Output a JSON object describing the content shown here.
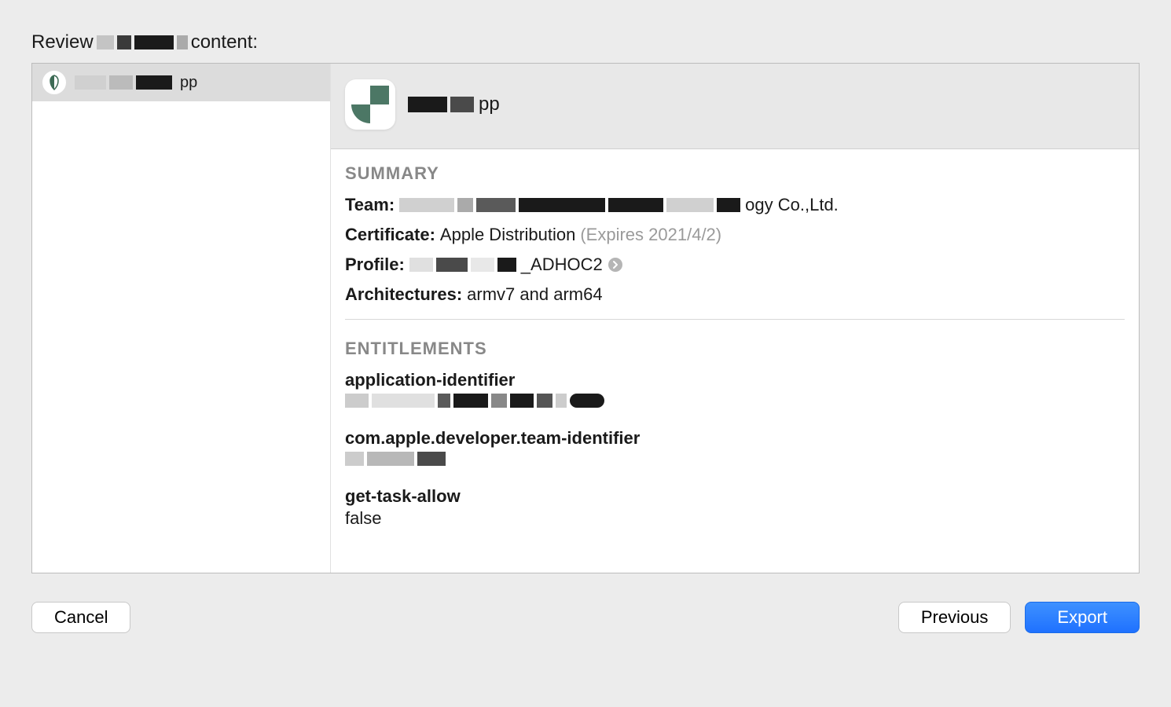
{
  "header": {
    "prefix": "Review",
    "suffix": "content:"
  },
  "sidebar": {
    "items": [
      {
        "app_suffix": "pp"
      }
    ]
  },
  "detail": {
    "app_suffix": "pp",
    "summary": {
      "title": "SUMMARY",
      "team_label": "Team:",
      "team_suffix": "ogy Co.,Ltd.",
      "certificate_label": "Certificate:",
      "certificate_value": "Apple Distribution",
      "certificate_expires": "(Expires 2021/4/2)",
      "profile_label": "Profile:",
      "profile_suffix": "_ADHOC2",
      "architectures_label": "Architectures:",
      "architectures_value": "armv7 and arm64"
    },
    "entitlements": {
      "title": "ENTITLEMENTS",
      "items": [
        {
          "key": "application-identifier",
          "value_redacted": true
        },
        {
          "key": "com.apple.developer.team-identifier",
          "value_redacted": true
        },
        {
          "key": "get-task-allow",
          "value": "false"
        }
      ]
    }
  },
  "buttons": {
    "cancel": "Cancel",
    "previous": "Previous",
    "export": "Export"
  }
}
